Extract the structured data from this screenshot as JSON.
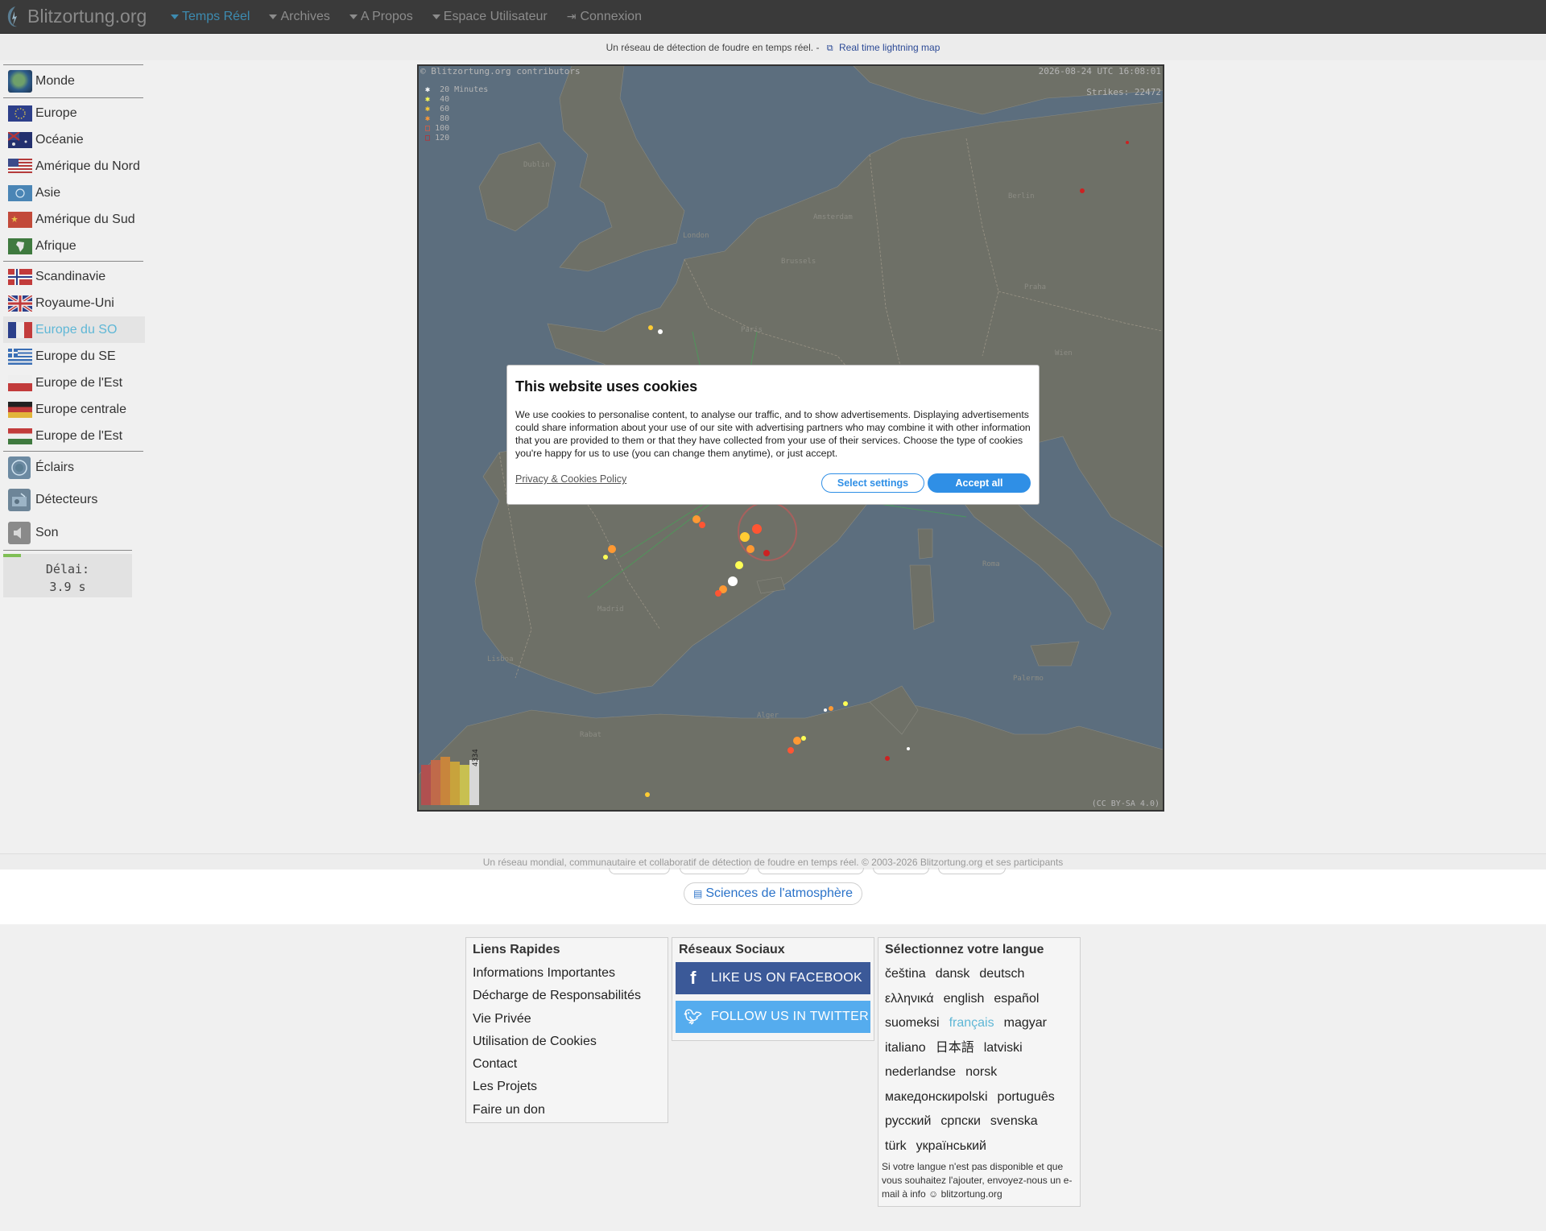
{
  "nav": {
    "brand": "Blitzortung.org",
    "items": [
      {
        "label": "Temps Réel",
        "active": true
      },
      {
        "label": "Archives",
        "active": false
      },
      {
        "label": "A Propos",
        "active": false
      },
      {
        "label": "Espace Utilisateur",
        "active": false
      }
    ],
    "login": "Connexion"
  },
  "subheader": {
    "text": "Un réseau de détection de foudre en temps réel. -",
    "link": "Real time lightning map"
  },
  "sidebar": {
    "world": "Monde",
    "continents": [
      "Europe",
      "Océanie",
      "Amérique du Nord",
      "Asie",
      "Amérique du Sud",
      "Afrique"
    ],
    "regions": [
      "Scandinavie",
      "Royaume-Uni",
      "Europe du SO",
      "Europe du SE",
      "Europe de l'Est",
      "Europe centrale",
      "Europe de l'Est"
    ],
    "active_region": "Europe du SO",
    "tools": [
      "Éclairs",
      "Détecteurs",
      "Son"
    ],
    "delay_label": "Délai:",
    "delay_value": "3.9 s"
  },
  "map": {
    "credit": "© Blitzortung.org contributors",
    "datetime": "2026-08-24 UTC 16:08:01",
    "strikes": "Strikes: 22472",
    "legend": [
      "20 Minutes",
      "40",
      "60",
      "80",
      "100",
      "120"
    ],
    "license": "(CC BY-SA 4.0)",
    "histogram_count": "4334",
    "cities": [
      "Dublin",
      "London",
      "Amsterdam",
      "Brussels",
      "Berlin",
      "Praha",
      "Wien",
      "Paris",
      "Madrid",
      "Lisboa",
      "Roma",
      "Palermo",
      "Alger",
      "Rabat"
    ],
    "colors": {
      "recent": "#ffffff",
      "c40": "#ffff55",
      "c60": "#ffcc33",
      "c80": "#ff9933",
      "c100": "#ff5533",
      "c120": "#cc2222"
    }
  },
  "cookie": {
    "title": "This website uses cookies",
    "body": "We use cookies to personalise content, to analyse our traffic, and to show advertisements. Displaying advertisements could share information about your use of our site with advertising partners who may combine it with other information that you are provided to them or that they have collected from your use of their services. Choose the type of cookies you're happy for us to use (you can change them anytime), or just accept.",
    "policy": "Privacy & Cookies Policy",
    "select": "Select settings",
    "accept": "Accept all"
  },
  "footer_strip": "Un réseau mondial, communautaire et collaboratif de détection de foudre en temps réel. © 2003-2026 Blitzortung.org et ses participants",
  "science_pill": "Sciences de l'atmosphère",
  "quick_links": {
    "title": "Liens Rapides",
    "items": [
      "Informations Importantes",
      "Décharge de Responsabilités",
      "Vie Privée",
      "Utilisation de Cookies",
      "Contact",
      "Les Projets",
      "Faire un don"
    ]
  },
  "social": {
    "title": "Réseaux Sociaux",
    "facebook": "LIKE US ON FACEBOOK",
    "twitter": "FOLLOW US IN TWITTER"
  },
  "language": {
    "title": "Sélectionnez votre langue",
    "items": [
      "čeština",
      "dansk",
      "deutsch",
      "ελληνικά",
      "english",
      "español",
      "suomeksi",
      "français",
      "magyar",
      "italiano",
      "日本語",
      "latviski",
      "nederlandse",
      "norsk",
      "македонски",
      "polski",
      "português",
      "русский",
      "српски",
      "svenska",
      "türk",
      "український"
    ],
    "active": "français",
    "note": "Si votre langue n'est pas disponible et que vous souhaitez l'ajouter, envoyez-nous un e-mail à info ☺ blitzortung.org"
  }
}
